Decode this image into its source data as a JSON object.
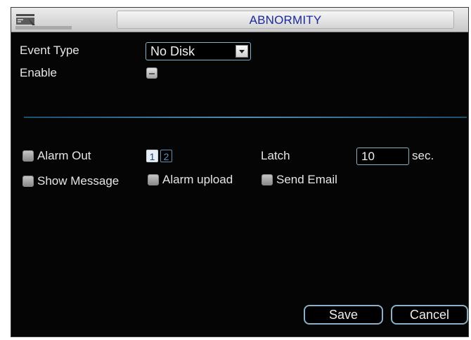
{
  "window": {
    "title": "ABNORMITY"
  },
  "icons": {
    "title": "settings-window-icon",
    "dropdown": "chevron-down-icon"
  },
  "colors": {
    "title_text": "#1b2a9a",
    "accent_border": "#8ab0c8",
    "background": "#050505"
  },
  "event": {
    "event_type_label": "Event Type",
    "event_type_value": "No Disk",
    "enable_label": "Enable"
  },
  "actions": {
    "alarm_out_label": "Alarm Out",
    "alarm_out_channels": [
      "1",
      "2"
    ],
    "latch_label": "Latch",
    "latch_value": "10",
    "latch_unit": "sec.",
    "show_message_label": "Show Message",
    "alarm_upload_label": "Alarm upload",
    "send_email_label": "Send Email"
  },
  "buttons": {
    "save": "Save",
    "cancel": "Cancel"
  }
}
